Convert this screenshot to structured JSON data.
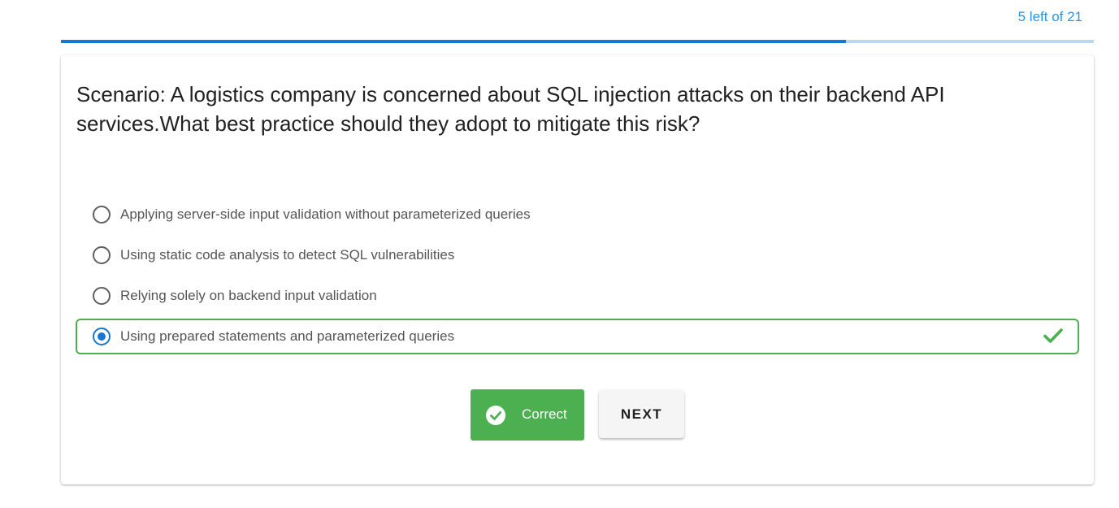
{
  "progress": {
    "text": "5 left of 21",
    "fraction": 0.76,
    "fill_color": "#1976d2",
    "track_color": "#b9d9f2",
    "text_color": "#2196f3"
  },
  "question": {
    "text": "Scenario: A logistics company is concerned about SQL injection attacks on their backend API services.What best practice should they adopt to mitigate this risk?"
  },
  "options": [
    {
      "label": "Applying server-side input validation without parameterized queries",
      "selected": false,
      "correct": false
    },
    {
      "label": "Using static code analysis to detect SQL vulnerabilities",
      "selected": false,
      "correct": false
    },
    {
      "label": "Relying solely on backend input validation",
      "selected": false,
      "correct": false
    },
    {
      "label": "Using prepared statements and parameterized queries",
      "selected": true,
      "correct": true,
      "icon": "check-icon"
    }
  ],
  "result_button": {
    "label": "Correct",
    "icon": "check-circle-icon",
    "color": "#4caf50"
  },
  "next_button": {
    "label": "NEXT"
  }
}
